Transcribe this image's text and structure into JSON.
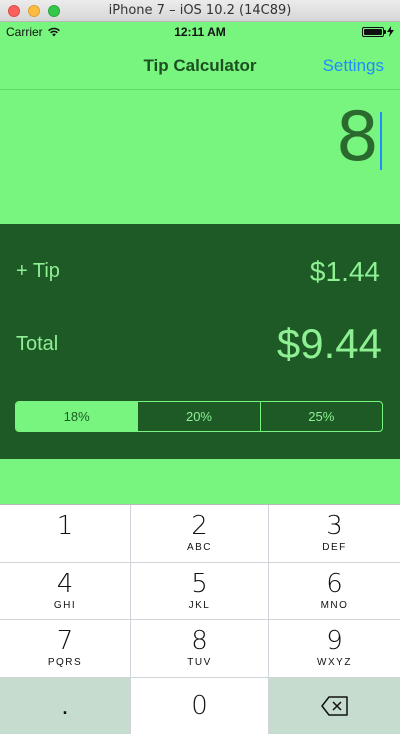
{
  "window": {
    "title": "iPhone 7 – iOS 10.2 (14C89)"
  },
  "status_bar": {
    "carrier": "Carrier",
    "time": "12:11 AM"
  },
  "nav": {
    "title": "Tip Calculator",
    "settings_label": "Settings"
  },
  "bill": {
    "value": "8"
  },
  "results": {
    "tip_label": "+ Tip",
    "tip_value": "$1.44",
    "total_label": "Total",
    "total_value": "$9.44"
  },
  "tip_options": [
    {
      "label": "18%",
      "selected": true
    },
    {
      "label": "20%",
      "selected": false
    },
    {
      "label": "25%",
      "selected": false
    }
  ],
  "keypad": {
    "keys": [
      {
        "num": "1",
        "letters": ""
      },
      {
        "num": "2",
        "letters": "ABC"
      },
      {
        "num": "3",
        "letters": "DEF"
      },
      {
        "num": "4",
        "letters": "GHI"
      },
      {
        "num": "5",
        "letters": "JKL"
      },
      {
        "num": "6",
        "letters": "MNO"
      },
      {
        "num": "7",
        "letters": "PQRS"
      },
      {
        "num": "8",
        "letters": "TUV"
      },
      {
        "num": "9",
        "letters": "WXYZ"
      }
    ],
    "dot": ".",
    "zero": "0"
  },
  "colors": {
    "screen_bg": "#78f57e",
    "results_bg": "#1d5a25",
    "results_text": "#8ef093",
    "accent": "#1e8cff"
  },
  "icons": [
    "wifi-icon",
    "battery-icon",
    "charging-icon",
    "delete-icon"
  ]
}
